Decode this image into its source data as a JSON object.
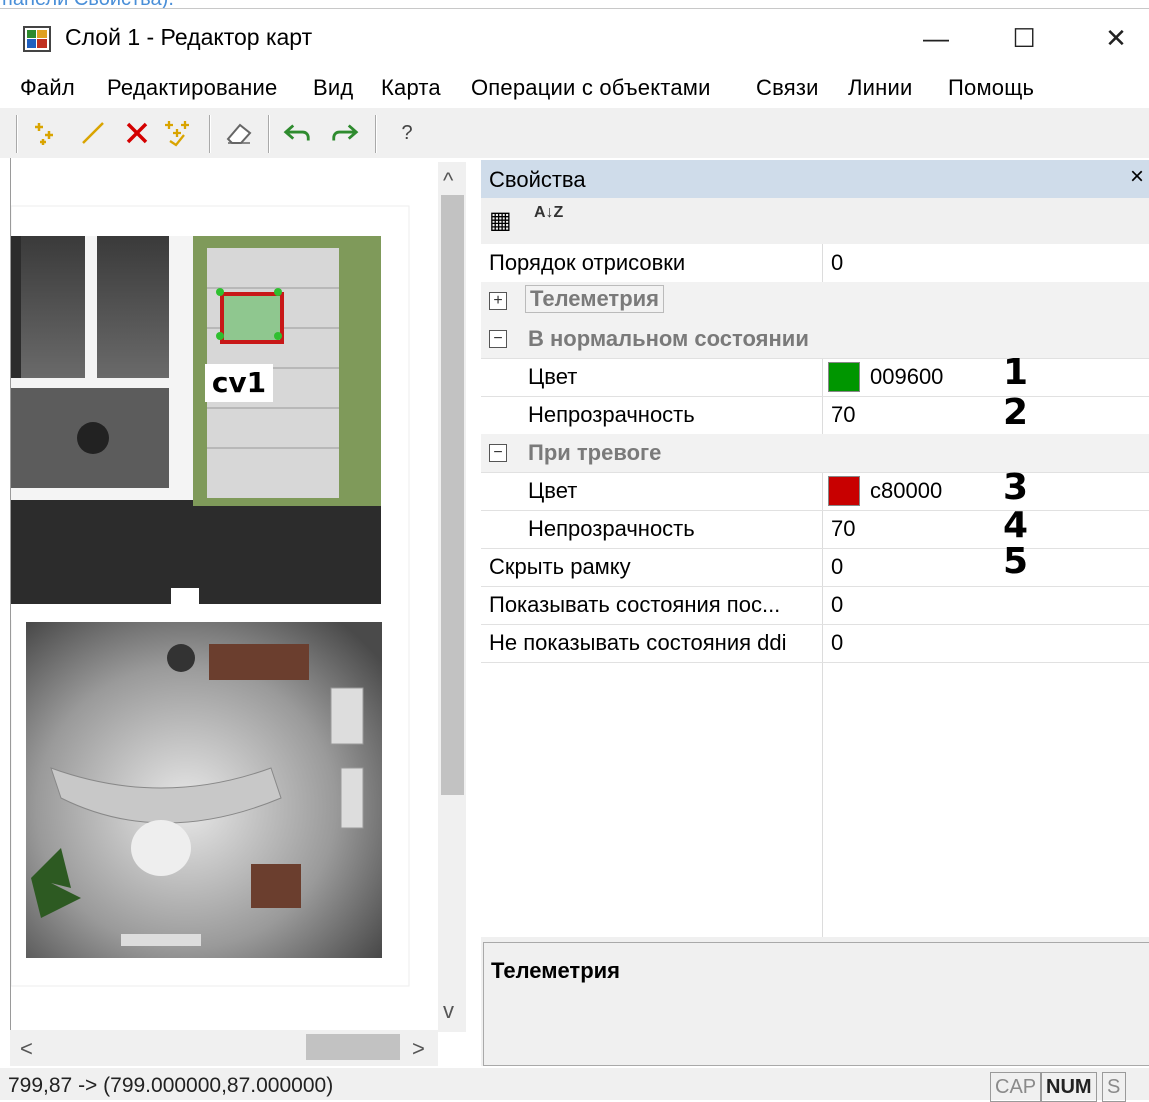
{
  "top_link_text": "панели Свойства).",
  "window": {
    "title": "Слой 1 - Редактор карт",
    "minimize_glyph": "—",
    "maximize_glyph": "☐",
    "close_glyph": "✕"
  },
  "menu": [
    "Файл",
    "Редактирование",
    "Вид",
    "Карта",
    "Операции с объектами",
    "Связи",
    "Линии",
    "Помощь"
  ],
  "toolbar": {
    "icons": [
      "add-point-icon",
      "draw-line-icon",
      "delete-icon",
      "add-multiple-points-icon",
      "eraser-icon",
      "undo-icon",
      "redo-icon",
      "help-icon"
    ],
    "help_glyph": "?"
  },
  "map": {
    "object_label": "cv1",
    "scroll_up": "^",
    "scroll_down": "v",
    "scroll_left": "<",
    "scroll_right": ">"
  },
  "properties": {
    "title": "Свойства",
    "close_glyph": "×",
    "sort_categorized_glyph": "▦",
    "sort_alpha_glyph": "A↓Z",
    "rows": {
      "draw_order": {
        "name": "Порядок отрисовки",
        "value": "0"
      },
      "telemetry": {
        "name": "Телеметрия",
        "sign": "+"
      },
      "normal": {
        "name": "В нормальном состоянии",
        "sign": "−"
      },
      "normal_color": {
        "name": "Цвет",
        "value": "009600",
        "swatch": "#009600"
      },
      "normal_opacity": {
        "name": "Непрозрачность",
        "value": "70"
      },
      "alarm": {
        "name": "При тревоге",
        "sign": "−"
      },
      "alarm_color": {
        "name": "Цвет",
        "value": "c80000",
        "swatch": "#c80000"
      },
      "alarm_opacity": {
        "name": "Непрозрачность",
        "value": "70"
      },
      "hide_frame": {
        "name": "Скрыть рамку",
        "value": "0"
      },
      "show_states": {
        "name": "Показывать состояния пос...",
        "value": "0"
      },
      "no_ddi_states": {
        "name": "Не показывать состояния ddi",
        "value": "0"
      }
    },
    "markers": [
      "1",
      "2",
      "3",
      "4",
      "5"
    ],
    "description_title": "Телеметрия"
  },
  "status": {
    "coords": "799,87 -> (799.000000,87.000000)",
    "cap": "CAP",
    "num": "NUM",
    "scrl": "S"
  }
}
